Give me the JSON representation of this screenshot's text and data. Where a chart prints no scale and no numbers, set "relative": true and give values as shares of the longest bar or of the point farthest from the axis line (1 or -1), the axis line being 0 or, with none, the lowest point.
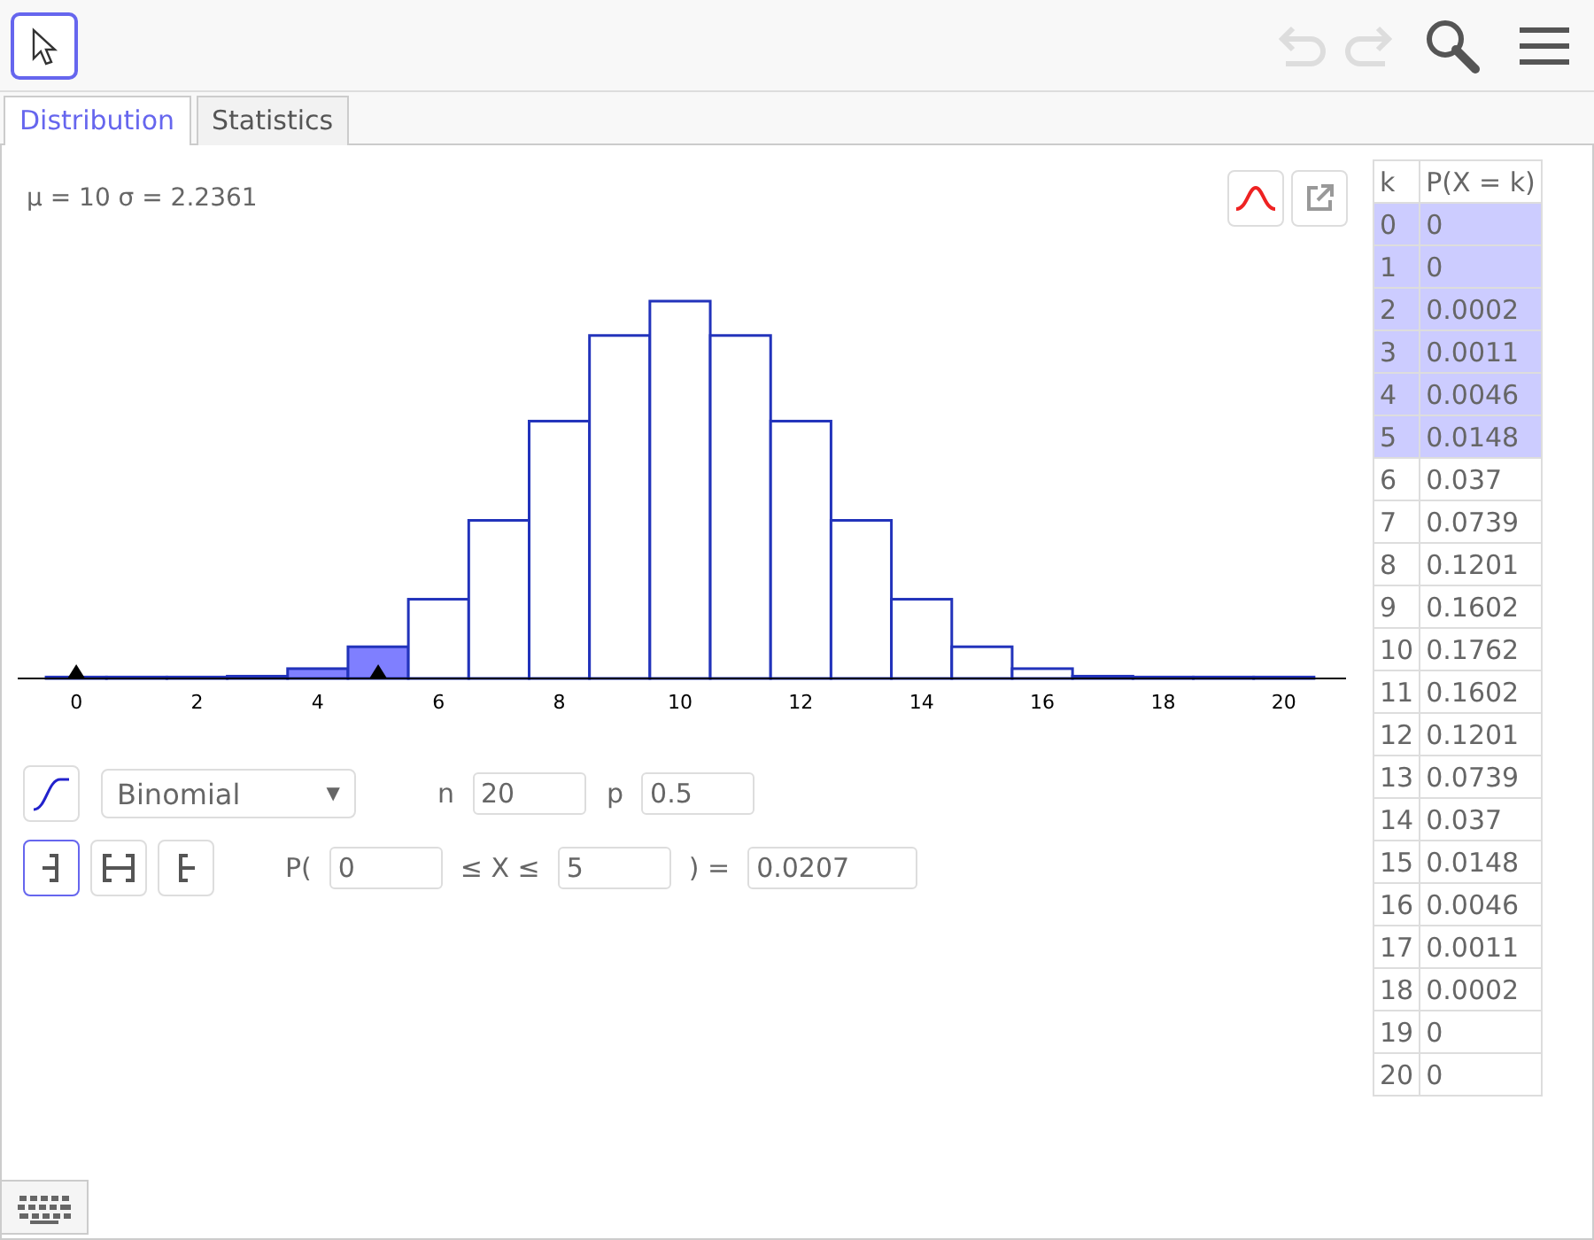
{
  "toolbar": {
    "undo": {
      "disabled": true
    },
    "redo": {
      "disabled": true
    }
  },
  "tabs": [
    {
      "label": "Distribution",
      "selected": true
    },
    {
      "label": "Statistics",
      "selected": false
    }
  ],
  "stats": "μ = 10 σ = 2.2361",
  "chart_data": {
    "type": "bar",
    "relative": true,
    "x": [
      0,
      1,
      2,
      3,
      4,
      5,
      6,
      7,
      8,
      9,
      10,
      11,
      12,
      13,
      14,
      15,
      16,
      17,
      18,
      19,
      20
    ],
    "values": [
      0,
      0,
      0.001,
      0.006,
      0.026,
      0.084,
      0.21,
      0.419,
      0.682,
      0.909,
      1,
      0.909,
      0.682,
      0.419,
      0.21,
      0.084,
      0.026,
      0.006,
      0.001,
      0,
      0
    ],
    "xlim": [
      -0.97,
      21.03
    ],
    "xticks": [
      0,
      2,
      4,
      6,
      8,
      10,
      12,
      14,
      16,
      18,
      20
    ]
  },
  "distribution": {
    "value": "Binomial",
    "caret": "▼",
    "params": [
      {
        "label": "n",
        "value": "20"
      },
      {
        "label": "p",
        "value": "0.5"
      }
    ]
  },
  "interval_modes": [
    {
      "kind": "left",
      "selected": true
    },
    {
      "kind": "interval",
      "selected": false
    },
    {
      "kind": "right",
      "selected": false
    }
  ],
  "probability": {
    "prefix": "P(",
    "low": "0",
    "middle": "≤ X ≤",
    "high": "5",
    "suffix": ") =",
    "result": "0.0207"
  },
  "table": {
    "columns": [
      "k",
      "P(X = k)"
    ],
    "rows": [
      {
        "k": "0",
        "p": "0",
        "selected": true
      },
      {
        "k": "1",
        "p": "0",
        "selected": true
      },
      {
        "k": "2",
        "p": "0.0002",
        "selected": true
      },
      {
        "k": "3",
        "p": "0.0011",
        "selected": true
      },
      {
        "k": "4",
        "p": "0.0046",
        "selected": true
      },
      {
        "k": "5",
        "p": "0.0148",
        "selected": true
      },
      {
        "k": "6",
        "p": "0.037",
        "selected": false
      },
      {
        "k": "7",
        "p": "0.0739",
        "selected": false
      },
      {
        "k": "8",
        "p": "0.1201",
        "selected": false
      },
      {
        "k": "9",
        "p": "0.1602",
        "selected": false
      },
      {
        "k": "10",
        "p": "0.1762",
        "selected": false
      },
      {
        "k": "11",
        "p": "0.1602",
        "selected": false
      },
      {
        "k": "12",
        "p": "0.1201",
        "selected": false
      },
      {
        "k": "13",
        "p": "0.0739",
        "selected": false
      },
      {
        "k": "14",
        "p": "0.037",
        "selected": false
      },
      {
        "k": "15",
        "p": "0.0148",
        "selected": false
      },
      {
        "k": "16",
        "p": "0.0046",
        "selected": false
      },
      {
        "k": "17",
        "p": "0.0011",
        "selected": false
      },
      {
        "k": "18",
        "p": "0.0002",
        "selected": false
      },
      {
        "k": "19",
        "p": "0",
        "selected": false
      },
      {
        "k": "20",
        "p": "0",
        "selected": false
      }
    ]
  }
}
